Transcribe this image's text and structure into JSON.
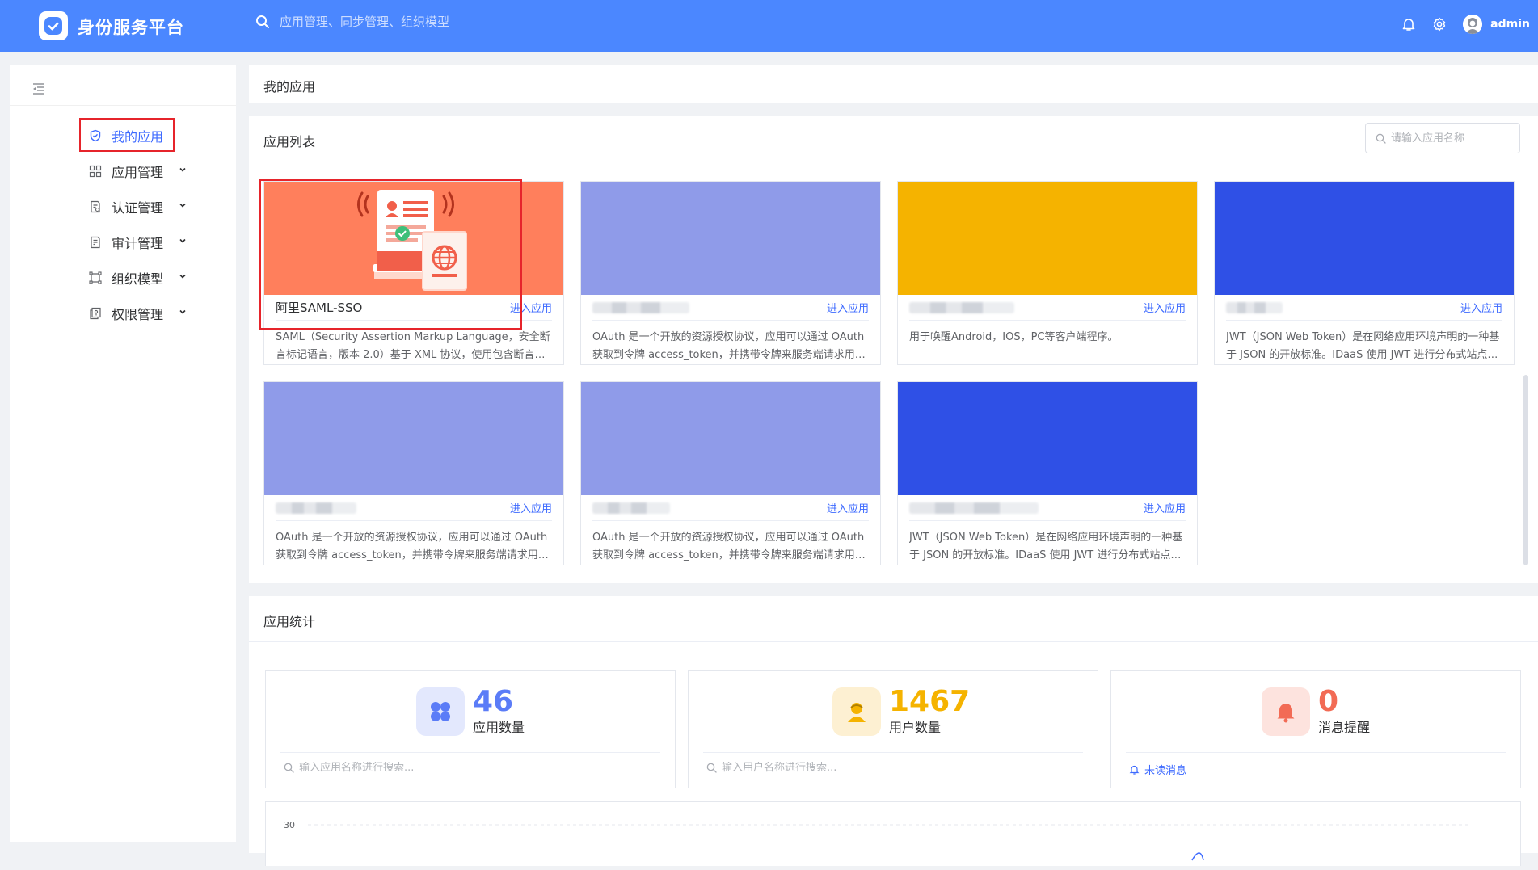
{
  "header": {
    "title": "身份服务平台",
    "search_placeholder": "应用管理、同步管理、组织模型",
    "username": "admin",
    "color": "#4b87ff"
  },
  "sidebar": {
    "items": [
      {
        "label": "我的应用",
        "icon": "shield-check-icon",
        "active": true
      },
      {
        "label": "应用管理",
        "icon": "grid-icon"
      },
      {
        "label": "认证管理",
        "icon": "doc-check-icon"
      },
      {
        "label": "审计管理",
        "icon": "doc-audit-icon"
      },
      {
        "label": "组织模型",
        "icon": "org-frame-icon"
      },
      {
        "label": "权限管理",
        "icon": "copy-key-icon"
      }
    ]
  },
  "breadcrumb": {
    "label": "我的应用"
  },
  "apps": {
    "title": "应用列表",
    "search_placeholder": "请输入应用名称",
    "enter_label": "进入应用",
    "cards": [
      {
        "name": "阿里SAML-SSO",
        "color": "#ff7f5c",
        "desc": "SAML（Security Assertion Markup Language，安全断言标记语言，版本 2.0）基于 XML 协议，使用包含断言（Assertion）的安全令牌，在授权方和消费方之间传递身份信息",
        "highlighted": true
      },
      {
        "name": "",
        "color": "#8f9be9",
        "desc": "OAuth 是一个开放的资源授权协议，应用可以通过 OAuth 获取到令牌 access_token，并携带令牌来服务端请求用户资源"
      },
      {
        "name": "",
        "color": "#f5b300",
        "desc": "用于唤醒Android，IOS，PC等客户端程序。"
      },
      {
        "name": "",
        "color": "#2f50e6",
        "desc": "JWT（JSON Web Token）是在网络应用环境声明的一种基于 JSON 的开放标准。IDaaS 使用 JWT 进行分布式站点的单点登录"
      },
      {
        "name": "",
        "color": "#8f9be9",
        "desc": "OAuth 是一个开放的资源授权协议，应用可以通过 OAuth 获取到令牌 access_token，并携带令牌来服务端请求用户资源"
      },
      {
        "name": "",
        "color": "#8f9be9",
        "desc": "OAuth 是一个开放的资源授权协议，应用可以通过 OAuth 获取到令牌 access_token，并携带令牌来服务端请求用户资源"
      },
      {
        "name": "",
        "color": "#2f50e6",
        "desc": "JWT（JSON Web Token）是在网络应用环境声明的一种基于 JSON 的开放标准。IDaaS 使用 JWT 进行分布式站点的单点登录"
      }
    ]
  },
  "stats": {
    "title": "应用统计",
    "items": [
      {
        "value": "46",
        "label": "应用数量",
        "color": "#5b7cf7",
        "bg": "#e3e8fd",
        "icon": "apps-icon",
        "footer_placeholder": "输入应用名称进行搜索..."
      },
      {
        "value": "1467",
        "label": "用户数量",
        "color": "#f5b300",
        "bg": "#fdf0d2",
        "icon": "user-icon",
        "footer_placeholder": "输入用户名称进行搜索..."
      },
      {
        "value": "0",
        "label": "消息提醒",
        "color": "#f26b55",
        "bg": "#fde3de",
        "icon": "bell-icon",
        "footer_link": "未读消息"
      }
    ]
  },
  "chart_data": {
    "type": "line",
    "ytick_top": "30"
  }
}
